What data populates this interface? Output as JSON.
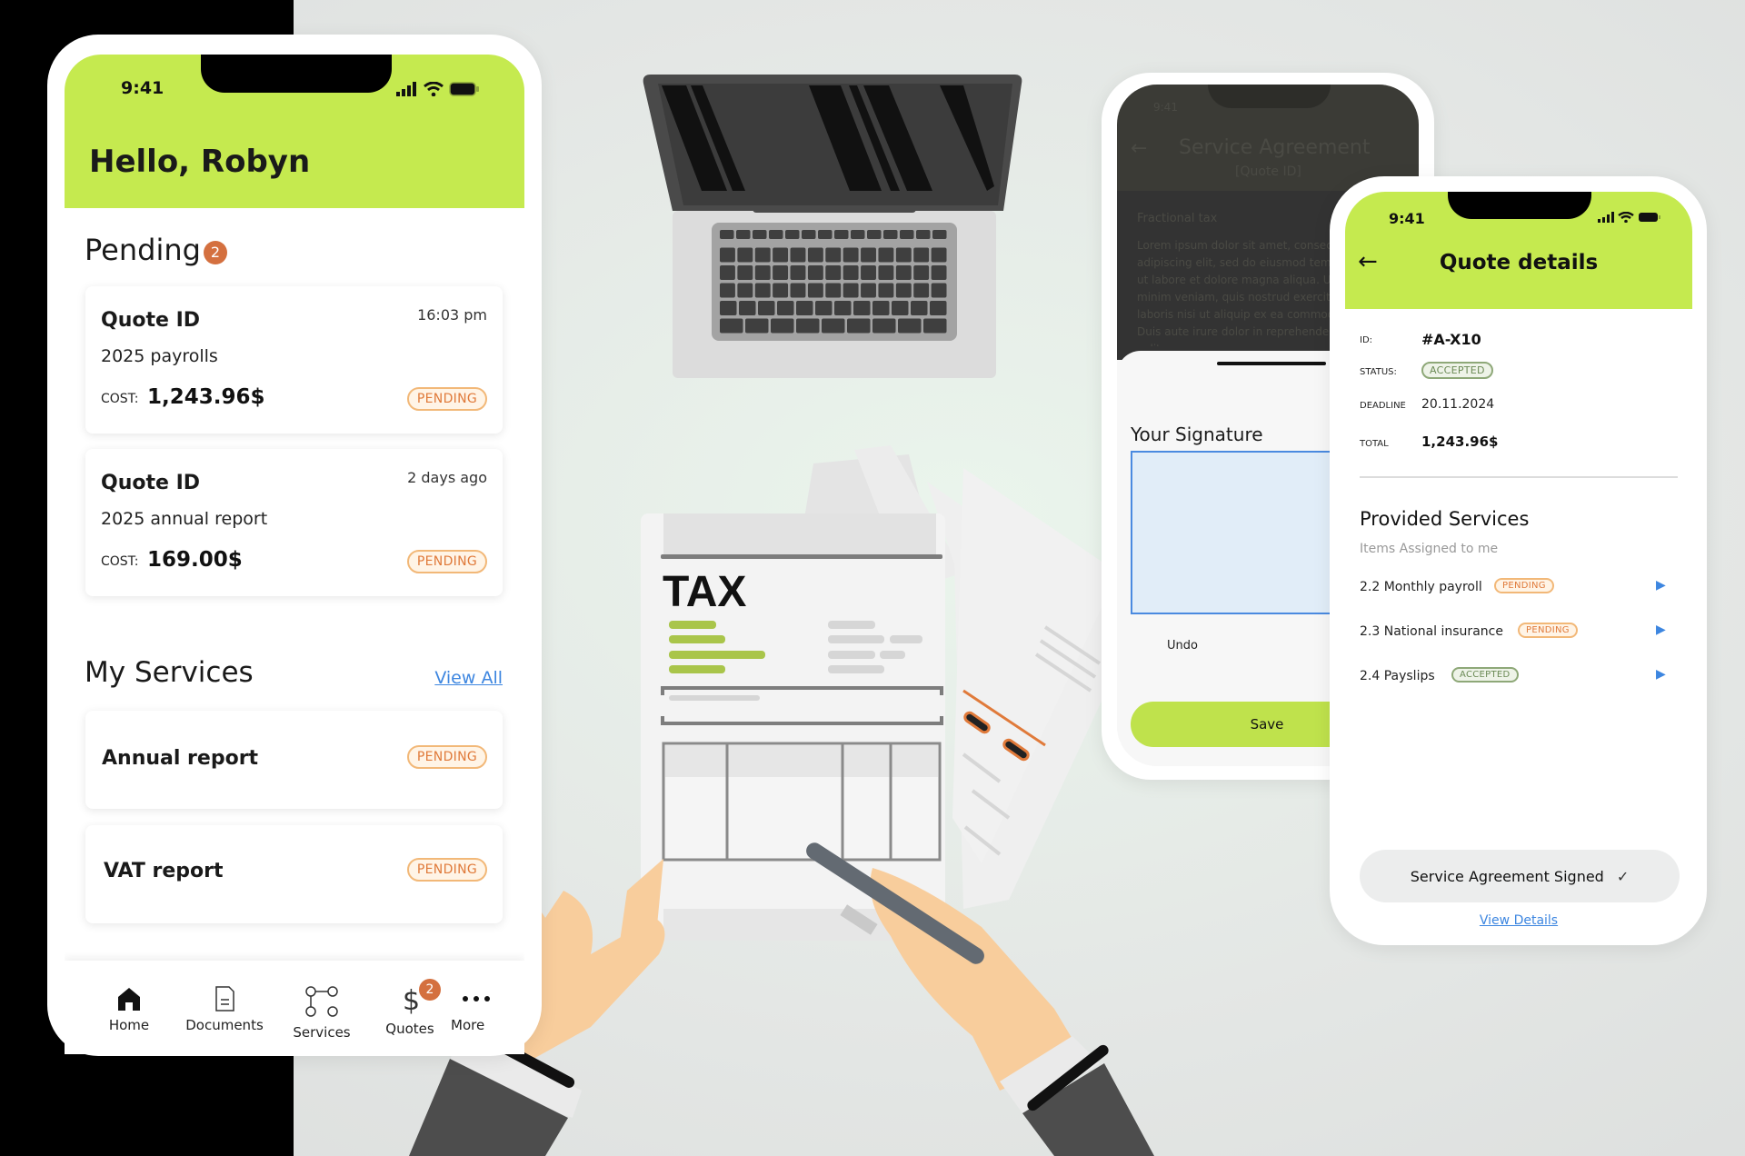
{
  "phone_home": {
    "status_time": "9:41",
    "greeting": "Hello, Robyn",
    "pending": {
      "title": "Pending",
      "count": "2",
      "cards": [
        {
          "title": "Quote ID",
          "time": "16:03 pm",
          "description": "2025 payrolls",
          "cost_label": "COST:",
          "cost": "1,243.96$",
          "status": "PENDING"
        },
        {
          "title": "Quote ID",
          "time": "2 days ago",
          "description": "2025 annual report",
          "cost_label": "COST:",
          "cost": "169.00$",
          "status": "PENDING"
        }
      ]
    },
    "services": {
      "title": "My Services",
      "view_all": "View All",
      "items": [
        {
          "name": "Annual report",
          "status": "PENDING"
        },
        {
          "name": "VAT report",
          "status": "PENDING"
        }
      ]
    },
    "nav": [
      {
        "label": "Home",
        "icon": "home-icon"
      },
      {
        "label": "Documents",
        "icon": "document-icon"
      },
      {
        "label": "Services",
        "icon": "services-icon"
      },
      {
        "label": "Quotes",
        "icon": "dollar-icon",
        "badge": "2"
      },
      {
        "label": "More",
        "icon": "more-icon"
      }
    ]
  },
  "phone_agreement": {
    "status_time": "9:41",
    "title": "Service Agreement",
    "subtitle": "[Quote ID]",
    "section": "Fractional tax",
    "body": "Lorem ipsum dolor sit amet, consectetur adipiscing elit, sed do eiusmod tempor incididunt ut labore et dolore magna aliqua. Ut enim ad minim veniam, quis nostrud exercitation ullamco laboris nisi ut aliquip ex ea commodo consequat. Duis aute irure dolor in reprehenderit in voluptate velit esse",
    "signature_label": "Your Signature",
    "undo": "Undo",
    "save": "Save"
  },
  "phone_quote": {
    "status_time": "9:41",
    "title": "Quote details",
    "fields": {
      "id_label": "ID:",
      "id": "#A-X10",
      "status_label": "STATUS:",
      "status": "ACCEPTED",
      "deadline_label": "DEADLINE",
      "deadline": "20.11.2024",
      "total_label": "TOTAL",
      "total": "1,243.96$"
    },
    "provided": {
      "title": "Provided Services",
      "subtitle": "Items Assigned to me",
      "items": [
        {
          "name": "2.2 Monthly payroll",
          "status": "PENDING"
        },
        {
          "name": "2.3 National insurance",
          "status": "PENDING"
        },
        {
          "name": "2.4 Payslips",
          "status": "ACCEPTED"
        }
      ]
    },
    "signed_button": "Service Agreement Signed",
    "view_details": "View Details"
  },
  "illustration": {
    "paper_title": "TAX"
  },
  "colors": {
    "accent": "#c5ea4f",
    "pending": "#e07a3a",
    "accepted": "#6b8a55",
    "link": "#3d86e0",
    "badge": "#d4703f"
  }
}
